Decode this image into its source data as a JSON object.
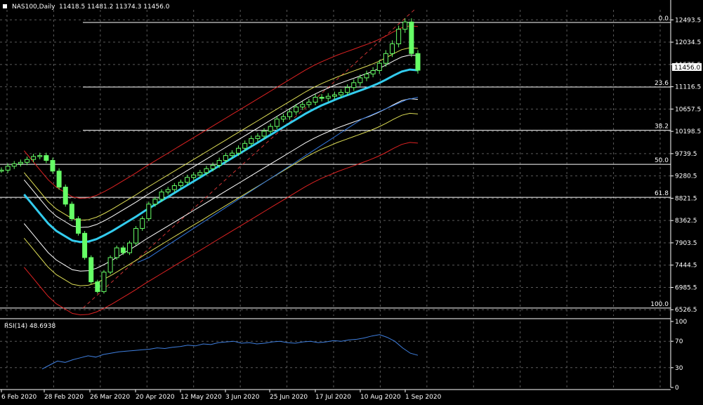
{
  "header": {
    "symbol": "NAS100,Daily",
    "ohlc": "11418.5  11481.2  11374.3  11456.0"
  },
  "rsi_header": "RSI(14) 48.6938",
  "current_price_label": "11456.0",
  "colors": {
    "background": "#000000",
    "grid": "#5a5a5a",
    "candle": "#66ff66",
    "ma_fast": "#33ccee",
    "ma_slow": "#3377dd",
    "envelope_yellow": "#dddd55",
    "envelope_red": "#dd2222",
    "bollinger": "#ffffff",
    "fib_line": "#ffffff",
    "rsi_line": "#3f7fdf"
  },
  "chart_data": [
    {
      "type": "line",
      "title": "NAS100,Daily",
      "y_ticks": [
        "12493.5",
        "12034.5",
        "11575.5",
        "11116.5",
        "10657.5",
        "10198.5",
        "9739.5",
        "9280.5",
        "8821.5",
        "8362.5",
        "7903.5",
        "7444.5",
        "6985.5",
        "6526.5"
      ],
      "ylim": [
        6400,
        12700
      ],
      "x_tick_labels": [
        "6 Feb 2020",
        "28 Feb 2020",
        "26 Mar 2020",
        "20 Apr 2020",
        "12 May 2020",
        "3 Jun 2020",
        "25 Jun 2020",
        "17 Jul 2020",
        "10 Aug 2020",
        "1 Sep 2020"
      ],
      "fibonacci": [
        {
          "label": "0.0",
          "value": 12440
        },
        {
          "label": "23.6",
          "value": 11110
        },
        {
          "label": "38.2",
          "value": 10220
        },
        {
          "label": "50.0",
          "value": 9520
        },
        {
          "label": "61.8",
          "value": 8840
        },
        {
          "label": "100.0",
          "value": 6560
        }
      ],
      "series": [
        {
          "name": "close",
          "values": [
            9400,
            9480,
            9530,
            9560,
            9620,
            9680,
            9700,
            9600,
            9380,
            9050,
            8700,
            8400,
            8100,
            7600,
            7100,
            6900,
            7300,
            7600,
            7800,
            7700,
            7900,
            8200,
            8400,
            8700,
            8800,
            8950,
            9000,
            9080,
            9150,
            9250,
            9300,
            9350,
            9430,
            9500,
            9600,
            9700,
            9750,
            9850,
            9950,
            10050,
            10100,
            10200,
            10300,
            10450,
            10500,
            10600,
            10700,
            10750,
            10800,
            10900,
            10880,
            10920,
            10950,
            11000,
            11100,
            11200,
            11300,
            11380,
            11450,
            11600,
            11800,
            12000,
            12300,
            12450,
            11800,
            11456
          ]
        },
        {
          "name": "ma_fast",
          "values": [
            null,
            null,
            null,
            8900,
            8700,
            8500,
            8300,
            8150,
            8050,
            7950,
            7920,
            7930,
            7980,
            8060,
            8150,
            8250,
            8350,
            8450,
            8560,
            8660,
            8760,
            8860,
            8960,
            9060,
            9160,
            9260,
            9360,
            9460,
            9560,
            9660,
            9760,
            9860,
            9960,
            10060,
            10160,
            10260,
            10360,
            10460,
            10560,
            10650,
            10730,
            10800,
            10870,
            10930,
            10990,
            11050,
            11110,
            11180,
            11260,
            11350,
            11430,
            11470,
            11456
          ]
        },
        {
          "name": "ma_slow",
          "values": [
            null,
            null,
            null,
            null,
            null,
            null,
            7500,
            7600,
            7750,
            7900,
            8050,
            8200,
            8350,
            8500,
            8650,
            8800,
            8950,
            9100,
            9250,
            9400,
            9550,
            9700,
            9850,
            10000,
            10150,
            10300,
            10450,
            10550,
            10650,
            10750,
            10850,
            10900
          ]
        }
      ]
    },
    {
      "type": "line",
      "title": "RSI(14) 48.6938",
      "y_ticks": [
        "100",
        "70",
        "30",
        "0"
      ],
      "ylim": [
        0,
        100
      ],
      "series": [
        {
          "name": "RSI(14)",
          "values": [
            28,
            34,
            40,
            38,
            42,
            45,
            48,
            46,
            50,
            52,
            54,
            55,
            56,
            57,
            58,
            60,
            59,
            61,
            62,
            64,
            63,
            66,
            65,
            68,
            69,
            70,
            67,
            68,
            66,
            67,
            69,
            70,
            68,
            67,
            69,
            70,
            68,
            69,
            71,
            70,
            72,
            73,
            75,
            78,
            80,
            76,
            70,
            60,
            52,
            48.69
          ]
        }
      ]
    }
  ]
}
